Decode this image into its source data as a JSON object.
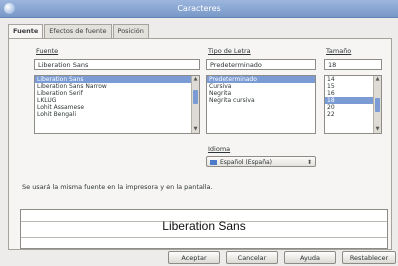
{
  "window": {
    "title": "Caracteres"
  },
  "tabs": [
    {
      "label": "Fuente"
    },
    {
      "label": "Efectos de fuente"
    },
    {
      "label": "Posición"
    }
  ],
  "font": {
    "label": "Fuente",
    "value": "Liberation Sans",
    "items": [
      {
        "label": "Liberation Sans"
      },
      {
        "label": "Liberation Sans Narrow"
      },
      {
        "label": "Liberation Serif"
      },
      {
        "label": "LKLUG"
      },
      {
        "label": "Lohit Assamese"
      },
      {
        "label": "Lohit Bengali"
      }
    ]
  },
  "style": {
    "label": "Tipo de Letra",
    "value": "Predeterminado",
    "items": [
      {
        "label": "Predeterminado"
      },
      {
        "label": "Cursiva"
      },
      {
        "label": "Negrita"
      },
      {
        "label": "Negrita cursiva"
      }
    ]
  },
  "size": {
    "label": "Tamaño",
    "value": "18",
    "items": [
      {
        "label": "14"
      },
      {
        "label": "15"
      },
      {
        "label": "16"
      },
      {
        "label": "18"
      },
      {
        "label": "20"
      },
      {
        "label": "22"
      }
    ]
  },
  "language": {
    "label": "Idioma",
    "value": "Español (España)"
  },
  "info": {
    "text": "Se usará la misma fuente en la impresora y en la pantalla."
  },
  "preview": {
    "text": "Liberation Sans"
  },
  "buttons": {
    "accept": "Aceptar",
    "cancel": "Cancelar",
    "help": "Ayuda",
    "reset": "Restablecer"
  },
  "colors": {
    "selection": "#7a9bd3",
    "titlebar": "#8aa8d4"
  }
}
